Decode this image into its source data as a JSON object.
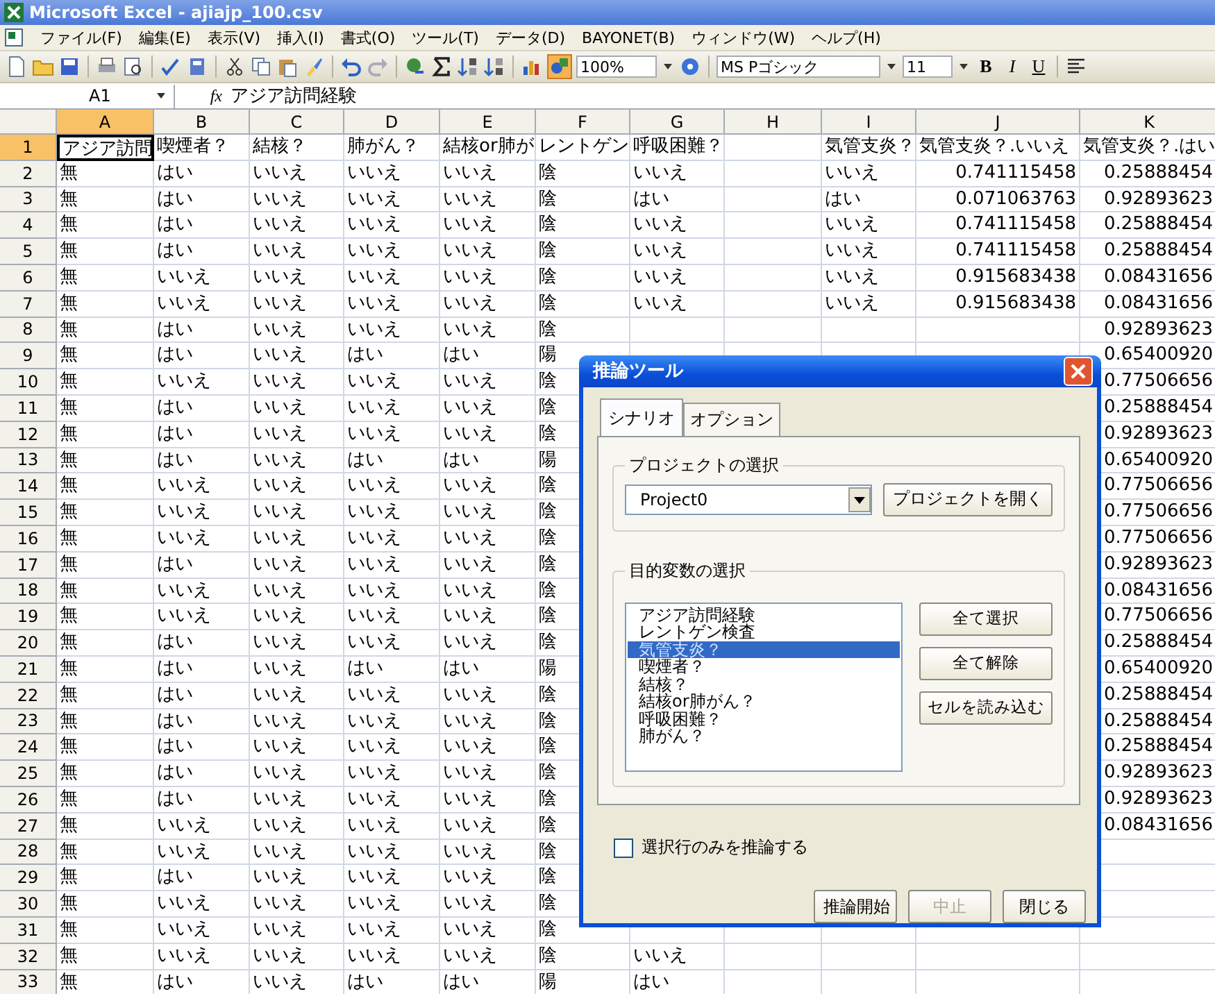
{
  "window": {
    "title": "Microsoft Excel - ajiajp_100.csv"
  },
  "menu": [
    "ファイル(F)",
    "編集(E)",
    "表示(V)",
    "挿入(I)",
    "書式(O)",
    "ツール(T)",
    "データ(D)",
    "BAYONET(B)",
    "ウィンドウ(W)",
    "ヘルプ(H)"
  ],
  "toolbar": {
    "drawing_active": true,
    "zoom": "100%",
    "font": "MS Pゴシック",
    "font_size": "11",
    "bold": "B",
    "italic": "I",
    "underline": "U"
  },
  "formula_bar": {
    "name_box": "A1",
    "fx": "fx",
    "content": "アジア訪問経験"
  },
  "sheet": {
    "columns": [
      {
        "label": "A",
        "selected": true
      },
      {
        "label": "B",
        "selected": false
      },
      {
        "label": "C",
        "selected": false
      },
      {
        "label": "D",
        "selected": false
      },
      {
        "label": "E",
        "selected": false
      },
      {
        "label": "F",
        "selected": false
      },
      {
        "label": "G",
        "selected": false
      },
      {
        "label": "H",
        "selected": false
      },
      {
        "label": "I",
        "selected": false
      },
      {
        "label": "J",
        "selected": false
      },
      {
        "label": "K",
        "selected": false
      }
    ],
    "rows": [
      {
        "label": "1",
        "selected": true,
        "cells": [
          "アジア訪問",
          "喫煙者？",
          "結核？",
          "肺がん？",
          "結核or肺が",
          "レントゲン",
          "呼吸困難？",
          null,
          "気管支炎？",
          "気管支炎？.いいえ",
          "気管支炎？.はい"
        ]
      },
      {
        "label": "2",
        "selected": false,
        "cells": [
          "無",
          "はい",
          "いいえ",
          "いいえ",
          "いいえ",
          "陰",
          "いいえ",
          null,
          "いいえ",
          "0.741115458",
          "0.25888454"
        ]
      },
      {
        "label": "3",
        "selected": false,
        "cells": [
          "無",
          "はい",
          "いいえ",
          "いいえ",
          "いいえ",
          "陰",
          "はい",
          null,
          "はい",
          "0.071063763",
          "0.92893623"
        ]
      },
      {
        "label": "4",
        "selected": false,
        "cells": [
          "無",
          "はい",
          "いいえ",
          "いいえ",
          "いいえ",
          "陰",
          "いいえ",
          null,
          "いいえ",
          "0.741115458",
          "0.25888454"
        ]
      },
      {
        "label": "5",
        "selected": false,
        "cells": [
          "無",
          "はい",
          "いいえ",
          "いいえ",
          "いいえ",
          "陰",
          "いいえ",
          null,
          "いいえ",
          "0.741115458",
          "0.25888454"
        ]
      },
      {
        "label": "6",
        "selected": false,
        "cells": [
          "無",
          "いいえ",
          "いいえ",
          "いいえ",
          "いいえ",
          "陰",
          "いいえ",
          null,
          "いいえ",
          "0.915683438",
          "0.08431656"
        ]
      },
      {
        "label": "7",
        "selected": false,
        "cells": [
          "無",
          "いいえ",
          "いいえ",
          "いいえ",
          "いいえ",
          "陰",
          "いいえ",
          null,
          "いいえ",
          "0.915683438",
          "0.08431656"
        ]
      },
      {
        "label": "8",
        "selected": false,
        "cells": [
          "無",
          "はい",
          "いいえ",
          "いいえ",
          "いいえ",
          "陰",
          null,
          null,
          null,
          null,
          "0.92893623"
        ]
      },
      {
        "label": "9",
        "selected": false,
        "cells": [
          "無",
          "はい",
          "いいえ",
          "はい",
          "はい",
          "陽",
          null,
          null,
          null,
          null,
          "0.65400920"
        ]
      },
      {
        "label": "10",
        "selected": false,
        "cells": [
          "無",
          "いいえ",
          "いいえ",
          "いいえ",
          "いいえ",
          "陰",
          null,
          null,
          null,
          null,
          "0.77506656"
        ]
      },
      {
        "label": "11",
        "selected": false,
        "cells": [
          "無",
          "はい",
          "いいえ",
          "いいえ",
          "いいえ",
          "陰",
          null,
          null,
          null,
          null,
          "0.25888454"
        ]
      },
      {
        "label": "12",
        "selected": false,
        "cells": [
          "無",
          "はい",
          "いいえ",
          "いいえ",
          "いいえ",
          "陰",
          null,
          null,
          null,
          null,
          "0.92893623"
        ]
      },
      {
        "label": "13",
        "selected": false,
        "cells": [
          "無",
          "はい",
          "いいえ",
          "はい",
          "はい",
          "陽",
          null,
          null,
          null,
          null,
          "0.65400920"
        ]
      },
      {
        "label": "14",
        "selected": false,
        "cells": [
          "無",
          "いいえ",
          "いいえ",
          "いいえ",
          "いいえ",
          "陰",
          null,
          null,
          null,
          null,
          "0.77506656"
        ]
      },
      {
        "label": "15",
        "selected": false,
        "cells": [
          "無",
          "いいえ",
          "いいえ",
          "いいえ",
          "いいえ",
          "陰",
          null,
          null,
          null,
          null,
          "0.77506656"
        ]
      },
      {
        "label": "16",
        "selected": false,
        "cells": [
          "無",
          "いいえ",
          "いいえ",
          "いいえ",
          "いいえ",
          "陰",
          null,
          null,
          null,
          null,
          "0.77506656"
        ]
      },
      {
        "label": "17",
        "selected": false,
        "cells": [
          "無",
          "はい",
          "いいえ",
          "いいえ",
          "いいえ",
          "陰",
          null,
          null,
          null,
          null,
          "0.92893623"
        ]
      },
      {
        "label": "18",
        "selected": false,
        "cells": [
          "無",
          "いいえ",
          "いいえ",
          "いいえ",
          "いいえ",
          "陰",
          null,
          null,
          null,
          null,
          "0.08431656"
        ]
      },
      {
        "label": "19",
        "selected": false,
        "cells": [
          "無",
          "いいえ",
          "いいえ",
          "いいえ",
          "いいえ",
          "陰",
          null,
          null,
          null,
          null,
          "0.77506656"
        ]
      },
      {
        "label": "20",
        "selected": false,
        "cells": [
          "無",
          "はい",
          "いいえ",
          "いいえ",
          "いいえ",
          "陰",
          null,
          null,
          null,
          null,
          "0.25888454"
        ]
      },
      {
        "label": "21",
        "selected": false,
        "cells": [
          "無",
          "はい",
          "いいえ",
          "はい",
          "はい",
          "陽",
          null,
          null,
          null,
          null,
          "0.65400920"
        ]
      },
      {
        "label": "22",
        "selected": false,
        "cells": [
          "無",
          "はい",
          "いいえ",
          "いいえ",
          "いいえ",
          "陰",
          null,
          null,
          null,
          null,
          "0.25888454"
        ]
      },
      {
        "label": "23",
        "selected": false,
        "cells": [
          "無",
          "はい",
          "いいえ",
          "いいえ",
          "いいえ",
          "陰",
          null,
          null,
          null,
          null,
          "0.25888454"
        ]
      },
      {
        "label": "24",
        "selected": false,
        "cells": [
          "無",
          "はい",
          "いいえ",
          "いいえ",
          "いいえ",
          "陰",
          null,
          null,
          null,
          null,
          "0.25888454"
        ]
      },
      {
        "label": "25",
        "selected": false,
        "cells": [
          "無",
          "はい",
          "いいえ",
          "いいえ",
          "いいえ",
          "陰",
          null,
          null,
          null,
          null,
          "0.92893623"
        ]
      },
      {
        "label": "26",
        "selected": false,
        "cells": [
          "無",
          "はい",
          "いいえ",
          "いいえ",
          "いいえ",
          "陰",
          null,
          null,
          null,
          null,
          "0.92893623"
        ]
      },
      {
        "label": "27",
        "selected": false,
        "cells": [
          "無",
          "いいえ",
          "いいえ",
          "いいえ",
          "いいえ",
          "陰",
          null,
          null,
          null,
          null,
          "0.08431656"
        ]
      },
      {
        "label": "28",
        "selected": false,
        "cells": [
          "無",
          "いいえ",
          "いいえ",
          "いいえ",
          "いいえ",
          "陰",
          null,
          null,
          null,
          null,
          null
        ]
      },
      {
        "label": "29",
        "selected": false,
        "cells": [
          "無",
          "はい",
          "いいえ",
          "いいえ",
          "いいえ",
          "陰",
          null,
          null,
          null,
          null,
          null
        ]
      },
      {
        "label": "30",
        "selected": false,
        "cells": [
          "無",
          "いいえ",
          "いいえ",
          "いいえ",
          "いいえ",
          "陰",
          null,
          null,
          null,
          null,
          null
        ]
      },
      {
        "label": "31",
        "selected": false,
        "cells": [
          "無",
          "いいえ",
          "いいえ",
          "いいえ",
          "いいえ",
          "陰",
          null,
          null,
          null,
          null,
          null
        ]
      },
      {
        "label": "32",
        "selected": false,
        "cells": [
          "無",
          "いいえ",
          "いいえ",
          "いいえ",
          "いいえ",
          "陰",
          "いいえ",
          null,
          null,
          null,
          null
        ]
      },
      {
        "label": "33",
        "selected": false,
        "cells": [
          "無",
          "はい",
          "いいえ",
          "はい",
          "はい",
          "陽",
          "はい",
          null,
          null,
          null,
          null
        ]
      }
    ]
  },
  "dialog": {
    "title": "推論ツール",
    "tabs": [
      {
        "label": "シナリオ",
        "selected": true
      },
      {
        "label": "オプション",
        "selected": false
      }
    ],
    "project_group": {
      "title": "プロジェクトの選択",
      "value": "Project0",
      "button": "プロジェクトを開く"
    },
    "target_group": {
      "title": "目的変数の選択",
      "items": [
        {
          "label": "アジア訪問経験",
          "selected": false
        },
        {
          "label": "レントゲン検査",
          "selected": false
        },
        {
          "label": "気管支炎？",
          "selected": true
        },
        {
          "label": "喫煙者？",
          "selected": false
        },
        {
          "label": "結核？",
          "selected": false
        },
        {
          "label": "結核or肺がん？",
          "selected": false
        },
        {
          "label": "呼吸困難？",
          "selected": false
        },
        {
          "label": "肺がん？",
          "selected": false
        }
      ],
      "buttons": [
        "全て選択",
        "全て解除",
        "セルを読み込む"
      ]
    },
    "checkbox": {
      "label": "選択行のみを推論する",
      "checked": false
    },
    "buttons": [
      {
        "label": "推論開始",
        "disabled": false
      },
      {
        "label": "中止",
        "disabled": true
      },
      {
        "label": "閉じる",
        "disabled": false
      }
    ]
  }
}
